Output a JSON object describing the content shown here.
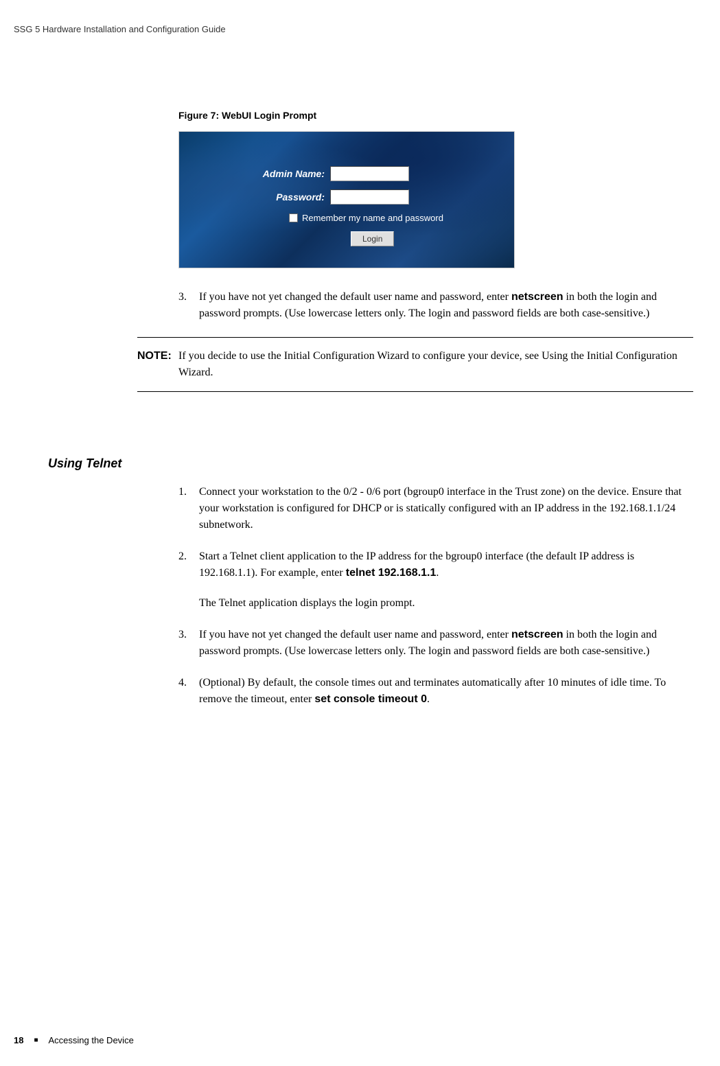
{
  "header": "SSG 5 Hardware Installation and Configuration Guide",
  "figure": {
    "caption": "Figure 7:  WebUI Login Prompt",
    "adminLabel": "Admin Name:",
    "passwordLabel": "Password:",
    "rememberText": "Remember my name and password",
    "loginButton": "Login"
  },
  "webui": {
    "step3": {
      "num": "3.",
      "text1": "If you have not yet changed the default user name and password, enter ",
      "bold": "netscreen",
      "text2": " in both the login and password prompts. (Use lowercase letters only. The login and password fields are both case-sensitive.)"
    }
  },
  "note": {
    "label": "NOTE:",
    "text": "If you decide to use the Initial Configuration Wizard to configure your device, see Using the Initial Configuration Wizard."
  },
  "telnet": {
    "heading": "Using Telnet",
    "step1": {
      "num": "1.",
      "text": "Connect your workstation to the 0/2 - 0/6 port (bgroup0 interface in the Trust zone) on the device. Ensure that your workstation is configured for DHCP or is statically configured with an IP address in the 192.168.1.1/24 subnetwork."
    },
    "step2": {
      "num": "2.",
      "text1": "Start a Telnet client application to the IP address for the bgroup0 interface (the default IP address is 192.168.1.1). For example, enter ",
      "bold": "telnet 192.168.1.1",
      "text2": ".",
      "note": "The Telnet application displays the login prompt."
    },
    "step3": {
      "num": "3.",
      "text1": "If you have not yet changed the default user name and password, enter ",
      "bold": "netscreen",
      "text2": " in both the login and password prompts. (Use lowercase letters only. The login and password fields are both case-sensitive.)"
    },
    "step4": {
      "num": "4.",
      "text1": "(Optional) By default, the console times out and terminates automatically after 10 minutes of idle time. To remove the timeout, enter ",
      "bold": "set console timeout 0",
      "text2": "."
    }
  },
  "footer": {
    "page": "18",
    "section": "Accessing the Device"
  }
}
